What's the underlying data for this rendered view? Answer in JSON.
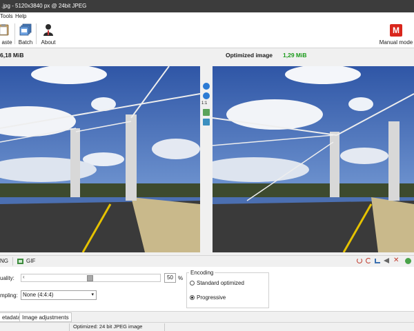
{
  "window": {
    "title": ".jpg - 5120x3840 px @ 24bit JPEG"
  },
  "menu": {
    "tools": "Tools",
    "help": "Help"
  },
  "toolbar": {
    "paste": "aste",
    "batch": "Batch",
    "about": "About",
    "mode_badge": "M",
    "mode_label": "Manual mode"
  },
  "info": {
    "original_size": "6,18 MiB",
    "optimized_label": "Optimized image",
    "optimized_size": "1,29 MiB"
  },
  "sidebar": {
    "ratio_label": "1:1"
  },
  "formats": {
    "png": "NG",
    "gif": "GIF"
  },
  "settings": {
    "quality_label": "uality:",
    "quality_value": "50",
    "quality_fraction": 0.5,
    "percent": "%",
    "sampling_label": "mpling:",
    "sampling_value": "None (4:4:4)",
    "encoding_label": "Encoding",
    "standard_label": "Standard optimized",
    "progressive_label": "Progressive",
    "selected_encoding": "progressive"
  },
  "tabs": {
    "metadata": "etadata",
    "adjustments": "Image adjustments"
  },
  "status": {
    "text": "Optimized: 24 bit JPEG image"
  },
  "colors": {
    "title_bg": "#3c3c3c",
    "size_green": "#1a9a1a",
    "mode_red": "#d9261c",
    "sky": "#3f66b0"
  }
}
